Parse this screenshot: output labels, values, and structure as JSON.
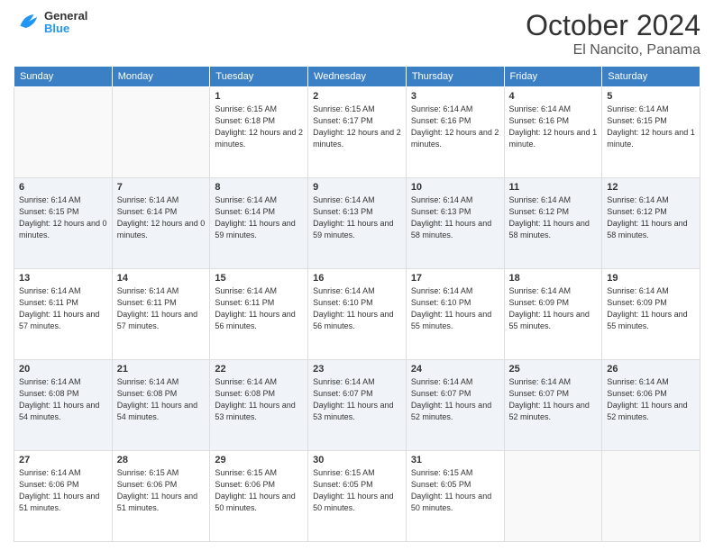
{
  "header": {
    "logo_line1": "General",
    "logo_line2": "Blue",
    "month": "October 2024",
    "location": "El Nancito, Panama"
  },
  "weekdays": [
    "Sunday",
    "Monday",
    "Tuesday",
    "Wednesday",
    "Thursday",
    "Friday",
    "Saturday"
  ],
  "weeks": [
    [
      {
        "day": "",
        "info": ""
      },
      {
        "day": "",
        "info": ""
      },
      {
        "day": "1",
        "info": "Sunrise: 6:15 AM\nSunset: 6:18 PM\nDaylight: 12 hours and 2 minutes."
      },
      {
        "day": "2",
        "info": "Sunrise: 6:15 AM\nSunset: 6:17 PM\nDaylight: 12 hours and 2 minutes."
      },
      {
        "day": "3",
        "info": "Sunrise: 6:14 AM\nSunset: 6:16 PM\nDaylight: 12 hours and 2 minutes."
      },
      {
        "day": "4",
        "info": "Sunrise: 6:14 AM\nSunset: 6:16 PM\nDaylight: 12 hours and 1 minute."
      },
      {
        "day": "5",
        "info": "Sunrise: 6:14 AM\nSunset: 6:15 PM\nDaylight: 12 hours and 1 minute."
      }
    ],
    [
      {
        "day": "6",
        "info": "Sunrise: 6:14 AM\nSunset: 6:15 PM\nDaylight: 12 hours and 0 minutes."
      },
      {
        "day": "7",
        "info": "Sunrise: 6:14 AM\nSunset: 6:14 PM\nDaylight: 12 hours and 0 minutes."
      },
      {
        "day": "8",
        "info": "Sunrise: 6:14 AM\nSunset: 6:14 PM\nDaylight: 11 hours and 59 minutes."
      },
      {
        "day": "9",
        "info": "Sunrise: 6:14 AM\nSunset: 6:13 PM\nDaylight: 11 hours and 59 minutes."
      },
      {
        "day": "10",
        "info": "Sunrise: 6:14 AM\nSunset: 6:13 PM\nDaylight: 11 hours and 58 minutes."
      },
      {
        "day": "11",
        "info": "Sunrise: 6:14 AM\nSunset: 6:12 PM\nDaylight: 11 hours and 58 minutes."
      },
      {
        "day": "12",
        "info": "Sunrise: 6:14 AM\nSunset: 6:12 PM\nDaylight: 11 hours and 58 minutes."
      }
    ],
    [
      {
        "day": "13",
        "info": "Sunrise: 6:14 AM\nSunset: 6:11 PM\nDaylight: 11 hours and 57 minutes."
      },
      {
        "day": "14",
        "info": "Sunrise: 6:14 AM\nSunset: 6:11 PM\nDaylight: 11 hours and 57 minutes."
      },
      {
        "day": "15",
        "info": "Sunrise: 6:14 AM\nSunset: 6:11 PM\nDaylight: 11 hours and 56 minutes."
      },
      {
        "day": "16",
        "info": "Sunrise: 6:14 AM\nSunset: 6:10 PM\nDaylight: 11 hours and 56 minutes."
      },
      {
        "day": "17",
        "info": "Sunrise: 6:14 AM\nSunset: 6:10 PM\nDaylight: 11 hours and 55 minutes."
      },
      {
        "day": "18",
        "info": "Sunrise: 6:14 AM\nSunset: 6:09 PM\nDaylight: 11 hours and 55 minutes."
      },
      {
        "day": "19",
        "info": "Sunrise: 6:14 AM\nSunset: 6:09 PM\nDaylight: 11 hours and 55 minutes."
      }
    ],
    [
      {
        "day": "20",
        "info": "Sunrise: 6:14 AM\nSunset: 6:08 PM\nDaylight: 11 hours and 54 minutes."
      },
      {
        "day": "21",
        "info": "Sunrise: 6:14 AM\nSunset: 6:08 PM\nDaylight: 11 hours and 54 minutes."
      },
      {
        "day": "22",
        "info": "Sunrise: 6:14 AM\nSunset: 6:08 PM\nDaylight: 11 hours and 53 minutes."
      },
      {
        "day": "23",
        "info": "Sunrise: 6:14 AM\nSunset: 6:07 PM\nDaylight: 11 hours and 53 minutes."
      },
      {
        "day": "24",
        "info": "Sunrise: 6:14 AM\nSunset: 6:07 PM\nDaylight: 11 hours and 52 minutes."
      },
      {
        "day": "25",
        "info": "Sunrise: 6:14 AM\nSunset: 6:07 PM\nDaylight: 11 hours and 52 minutes."
      },
      {
        "day": "26",
        "info": "Sunrise: 6:14 AM\nSunset: 6:06 PM\nDaylight: 11 hours and 52 minutes."
      }
    ],
    [
      {
        "day": "27",
        "info": "Sunrise: 6:14 AM\nSunset: 6:06 PM\nDaylight: 11 hours and 51 minutes."
      },
      {
        "day": "28",
        "info": "Sunrise: 6:15 AM\nSunset: 6:06 PM\nDaylight: 11 hours and 51 minutes."
      },
      {
        "day": "29",
        "info": "Sunrise: 6:15 AM\nSunset: 6:06 PM\nDaylight: 11 hours and 50 minutes."
      },
      {
        "day": "30",
        "info": "Sunrise: 6:15 AM\nSunset: 6:05 PM\nDaylight: 11 hours and 50 minutes."
      },
      {
        "day": "31",
        "info": "Sunrise: 6:15 AM\nSunset: 6:05 PM\nDaylight: 11 hours and 50 minutes."
      },
      {
        "day": "",
        "info": ""
      },
      {
        "day": "",
        "info": ""
      }
    ]
  ]
}
